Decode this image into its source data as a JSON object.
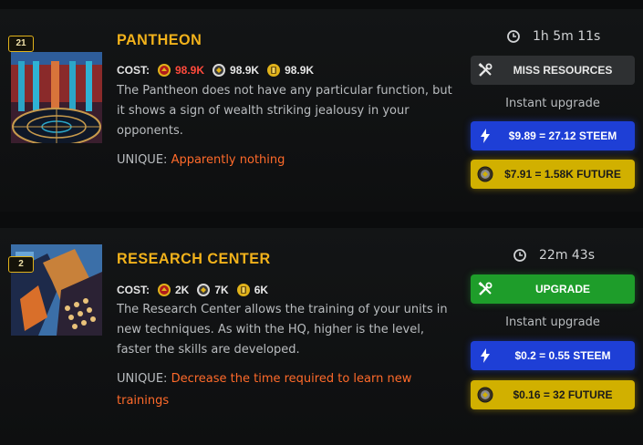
{
  "buildings": [
    {
      "level": "21",
      "title": "PANTHEON",
      "cost_label": "COST:",
      "cost": [
        "98.9K",
        "98.9K",
        "98.9K"
      ],
      "description": "The Pantheon does not have any particular function, but it shows a sign of wealth striking jealousy in your opponents.",
      "unique_label": "UNIQUE:",
      "unique_value": "Apparently nothing",
      "timer": "1h 5m 11s",
      "action_label": "MISS RESOURCES",
      "instant_label": "Instant upgrade",
      "steem_label": "$9.89 = 27.12 STEEM",
      "future_label": "$7.91 = 1.58K FUTURE"
    },
    {
      "level": "2",
      "title": "RESEARCH CENTER",
      "cost_label": "COST:",
      "cost": [
        "2K",
        "7K",
        "6K"
      ],
      "description": "The Research Center allows the training of your units in new techniques. As with the HQ, higher is the level, faster the skills are developed.",
      "unique_label": "UNIQUE:",
      "unique_value": "Decrease the time required to learn new trainings",
      "timer": "22m 43s",
      "action_label": "UPGRADE",
      "instant_label": "Instant upgrade",
      "steem_label": "$0.2 = 0.55 STEEM",
      "future_label": "$0.16 = 32 FUTURE"
    }
  ],
  "colors": {
    "title": "#f2b21b",
    "unique_value": "#ff6a2a",
    "cost_short": "#ff4a3c",
    "miss_resources_bg": "#2e3032",
    "upgrade_bg": "#1e9d2a",
    "steem_bg": "#1e3fd6",
    "future_bg": "#d1b000"
  },
  "icons": {
    "resources": [
      "food-icon",
      "coin-icon",
      "gold-icon"
    ],
    "timer": "clock-icon",
    "action": "tools-icon",
    "steem": "lightning-icon",
    "future": "future-token-icon"
  }
}
